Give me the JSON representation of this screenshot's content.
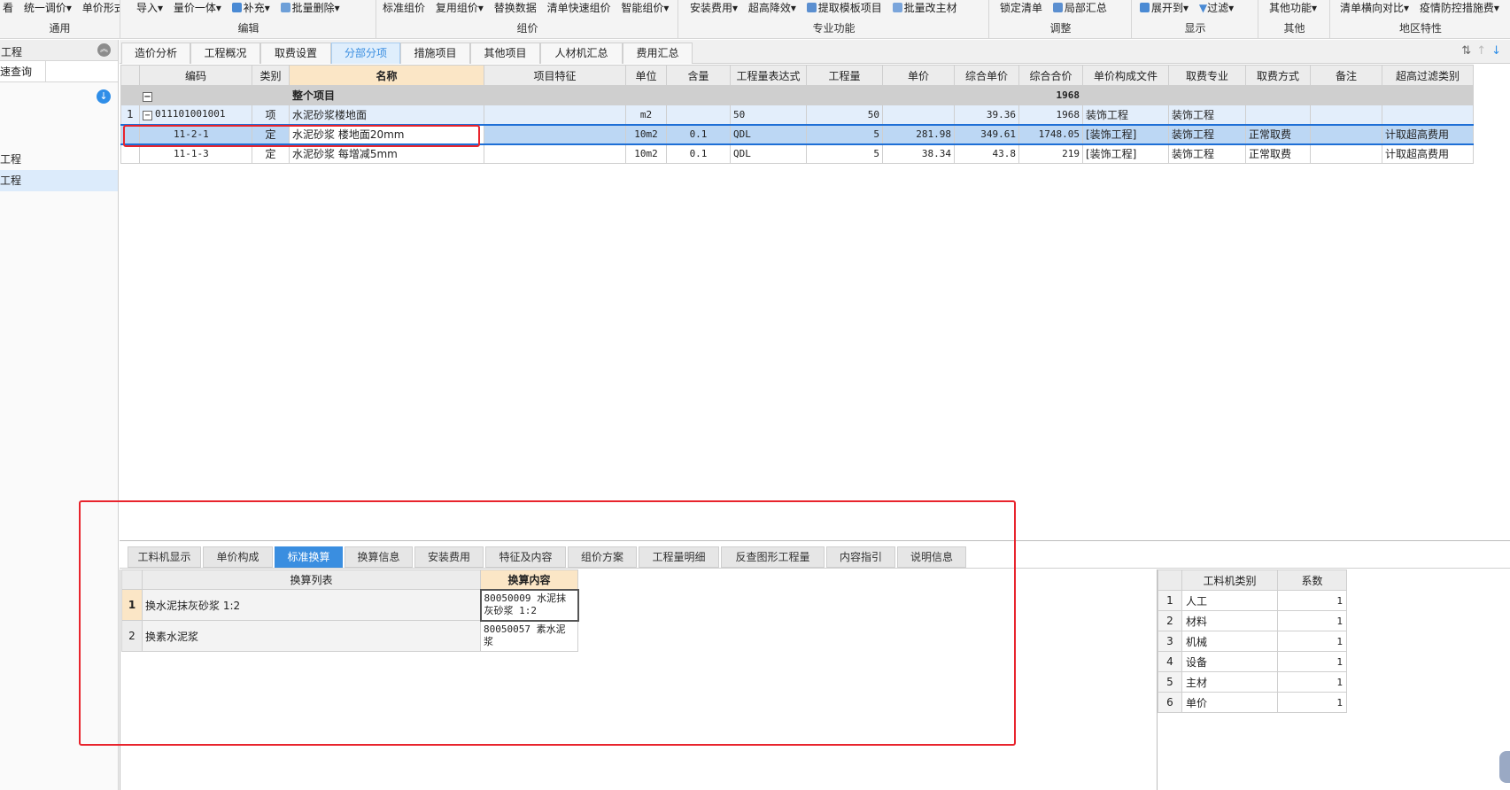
{
  "ribbon": {
    "groups": [
      {
        "label": "通用",
        "buttons": [
          "看",
          "统一调价",
          "单价形式"
        ]
      },
      {
        "label": "编辑",
        "buttons": [
          "导入",
          "量价一体",
          "补充",
          "批量删除"
        ]
      },
      {
        "label": "组价",
        "buttons": [
          "标准组价",
          "复用组价",
          "替换数据",
          "清单快速组价",
          "智能组价"
        ]
      },
      {
        "label": "专业功能",
        "buttons": [
          "安装费用",
          "超高降效",
          "提取模板项目",
          "批量改主材"
        ]
      },
      {
        "label": "调整",
        "buttons": [
          "锁定清单",
          "局部汇总"
        ]
      },
      {
        "label": "显示",
        "buttons": [
          "展开到",
          "过滤"
        ]
      },
      {
        "label": "其他",
        "buttons": [
          "其他功能"
        ]
      },
      {
        "label": "地区特性",
        "buttons": [
          "清单横向对比",
          "疫情防控措施费"
        ]
      }
    ]
  },
  "left_panel": {
    "title": "工程",
    "tab": "速查询",
    "items": [
      "工程",
      "工程"
    ]
  },
  "main_tabs": [
    "造价分析",
    "工程概况",
    "取费设置",
    "分部分项",
    "措施项目",
    "其他项目",
    "人材机汇总",
    "费用汇总"
  ],
  "main_tabs_active": "分部分项",
  "grid": {
    "headers": [
      "",
      "编码",
      "类别",
      "名称",
      "项目特征",
      "单位",
      "含量",
      "工程量表达式",
      "工程量",
      "单价",
      "综合单价",
      "综合合价",
      "单价构成文件",
      "取费专业",
      "取费方式",
      "备注",
      "超高过滤类别"
    ],
    "total_row": {
      "label": "整个项目",
      "total": "1968"
    },
    "rows": [
      {
        "idx": "1",
        "code": "011101001001",
        "type": "项",
        "name": "水泥砂浆楼地面",
        "feature": "",
        "unit": "m2",
        "content": "",
        "expr": "50",
        "qty": "50",
        "price": "",
        "comp_price": "39.36",
        "comp_total": "1968",
        "file": "装饰工程",
        "spec": "装饰工程",
        "method": "",
        "note": "",
        "filter": ""
      },
      {
        "idx": "",
        "code": "11-2-1",
        "type": "定",
        "name": "水泥砂浆 楼地面20mm",
        "feature": "",
        "unit": "10m2",
        "content": "0.1",
        "expr": "QDL",
        "qty": "5",
        "price": "281.98",
        "comp_price": "349.61",
        "comp_total": "1748.05",
        "file": "[装饰工程]",
        "spec": "装饰工程",
        "method": "正常取费",
        "note": "",
        "filter": "计取超高费用"
      },
      {
        "idx": "",
        "code": "11-1-3",
        "type": "定",
        "name": "水泥砂浆 每增减5mm",
        "feature": "",
        "unit": "10m2",
        "content": "0.1",
        "expr": "QDL",
        "qty": "5",
        "price": "38.34",
        "comp_price": "43.8",
        "comp_total": "219",
        "file": "[装饰工程]",
        "spec": "装饰工程",
        "method": "正常取费",
        "note": "",
        "filter": "计取超高费用"
      }
    ]
  },
  "sub_tabs": [
    "工料机显示",
    "单价构成",
    "标准换算",
    "换算信息",
    "安装费用",
    "特征及内容",
    "组价方案",
    "工程量明细",
    "反查图形工程量",
    "内容指引",
    "说明信息"
  ],
  "sub_tabs_active": "标准换算",
  "conversion": {
    "headers": [
      "换算列表",
      "换算内容"
    ],
    "rows": [
      {
        "idx": "1",
        "item": "换水泥抹灰砂浆 1:2",
        "content": "80050009  水泥抹灰砂浆 1:2"
      },
      {
        "idx": "2",
        "item": "换素水泥浆",
        "content": "80050057  素水泥浆"
      }
    ]
  },
  "coefficients": {
    "headers": [
      "工料机类别",
      "系数"
    ],
    "rows": [
      {
        "idx": "1",
        "type": "人工",
        "value": "1"
      },
      {
        "idx": "2",
        "type": "材料",
        "value": "1"
      },
      {
        "idx": "3",
        "type": "机械",
        "value": "1"
      },
      {
        "idx": "4",
        "type": "设备",
        "value": "1"
      },
      {
        "idx": "5",
        "type": "主材",
        "value": "1"
      },
      {
        "idx": "6",
        "type": "单价",
        "value": "1"
      }
    ]
  },
  "colors": {
    "accent": "#3a8ee0",
    "highlight_header": "#fbe6c6",
    "annotation": "#e8242d"
  }
}
